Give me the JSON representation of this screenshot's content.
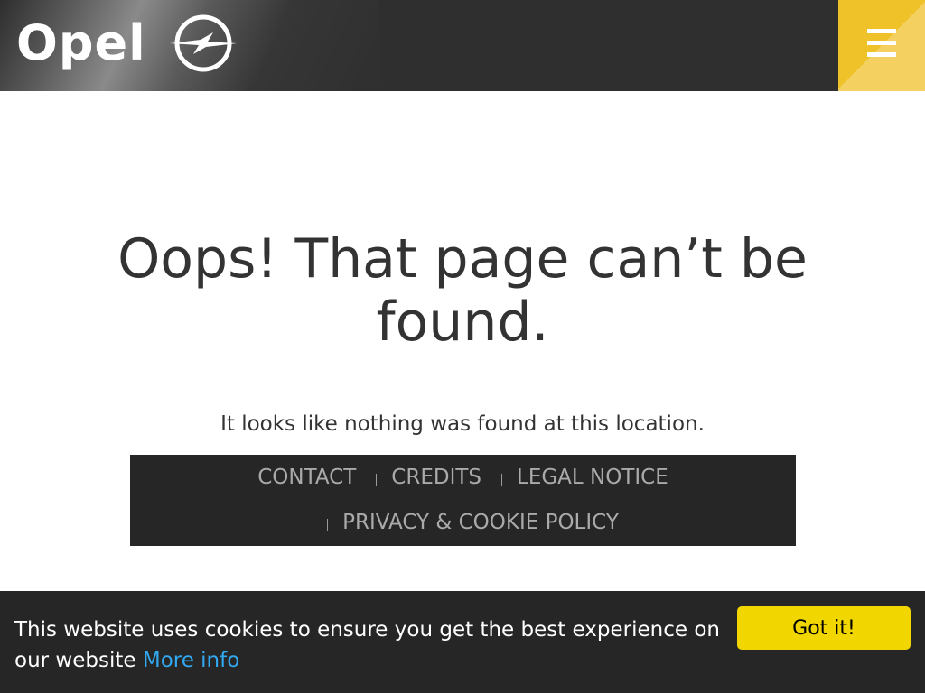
{
  "header": {
    "brand_name": "Opel",
    "logo_icon": "opel-blitz-icon",
    "menu_icon": "hamburger-menu-icon",
    "accent_color": "#f0c22a"
  },
  "main": {
    "title": "Oops! That page can’t be found.",
    "message": "It looks like nothing was found at this location."
  },
  "footer_nav": {
    "links": [
      {
        "label": "CONTACT"
      },
      {
        "label": "CREDITS"
      },
      {
        "label": "LEGAL NOTICE"
      },
      {
        "label": "PRIVACY & COOKIE POLICY"
      }
    ]
  },
  "cookie_banner": {
    "message": "This website uses cookies to ensure you get the best experience on our website",
    "more_info_label": "More info",
    "accept_label": "Got it!",
    "accept_color": "#f1d600",
    "link_color": "#31a8f0"
  }
}
